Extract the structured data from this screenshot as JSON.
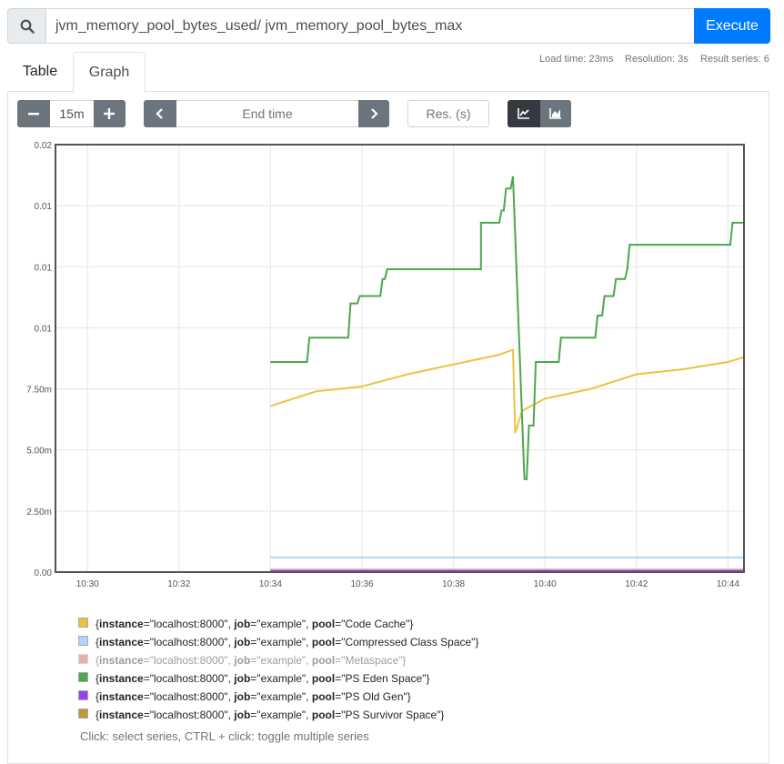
{
  "query": {
    "value": "jvm_memory_pool_bytes_used/ jvm_memory_pool_bytes_max"
  },
  "execute_label": "Execute",
  "tabs": {
    "table": "Table",
    "graph": "Graph"
  },
  "stats": {
    "load_time": "Load time: 23ms",
    "resolution": "Resolution: 3s",
    "result_series": "Result series: 6"
  },
  "controls": {
    "range": "15m",
    "end_time_placeholder": "End time",
    "res_placeholder": "Res. (s)"
  },
  "chart_data": {
    "type": "line",
    "x_ticks": [
      "10:30",
      "10:32",
      "10:34",
      "10:36",
      "10:38",
      "10:40",
      "10:42",
      "10:44"
    ],
    "y_ticks": [
      "0.00",
      "2.50m",
      "5.00m",
      "7.50m",
      "0.01",
      "0.01",
      "0.01",
      "0.02"
    ],
    "ylim": [
      0,
      0.0175
    ],
    "xlim_minutes": [
      29.3,
      44.35
    ],
    "grid": true,
    "series": [
      {
        "name": "Code Cache",
        "color": "#edc240",
        "x": [
          34.0,
          34.5,
          35.0,
          36.0,
          37.0,
          38.0,
          39.0,
          39.3,
          39.35,
          39.5,
          40.0,
          41.0,
          42.0,
          43.0,
          44.0,
          44.35
        ],
        "y": [
          0.0068,
          0.0071,
          0.0074,
          0.0076,
          0.0081,
          0.0085,
          0.0089,
          0.0091,
          0.0057,
          0.0066,
          0.0071,
          0.0075,
          0.0081,
          0.0083,
          0.0086,
          0.0088
        ]
      },
      {
        "name": "Compressed Class Space",
        "color": "#afd8f8",
        "x": [
          34.0,
          39.3,
          39.4,
          44.35
        ],
        "y": [
          0.0006,
          0.0006,
          0.0006,
          0.0006
        ]
      },
      {
        "name": "Metaspace",
        "color": "#cb4b4b",
        "x": [
          34.0,
          44.35
        ],
        "y": [
          0.0001,
          0.0001
        ]
      },
      {
        "name": "PS Eden Space",
        "color": "#4da74d",
        "x": [
          34.0,
          34.8,
          34.85,
          35.7,
          35.75,
          35.9,
          35.95,
          36.4,
          36.45,
          36.5,
          36.55,
          37.0,
          37.05,
          37.05,
          38.55,
          38.6,
          38.6,
          39.0,
          39.05,
          39.1,
          39.15,
          39.25,
          39.3,
          39.55,
          39.6,
          39.65,
          39.75,
          39.8,
          39.85,
          40.3,
          40.35,
          41.1,
          41.15,
          41.25,
          41.3,
          41.5,
          41.55,
          41.75,
          41.8,
          41.85,
          44.05,
          44.1,
          44.35
        ],
        "y": [
          0.0086,
          0.0086,
          0.0096,
          0.0096,
          0.011,
          0.011,
          0.0113,
          0.0113,
          0.012,
          0.012,
          0.0124,
          0.0124,
          0.0124,
          0.0124,
          0.0124,
          0.0124,
          0.0143,
          0.0143,
          0.0148,
          0.0148,
          0.0157,
          0.0157,
          0.0162,
          0.0038,
          0.0038,
          0.006,
          0.006,
          0.0086,
          0.0086,
          0.0086,
          0.0096,
          0.0096,
          0.0105,
          0.0105,
          0.0113,
          0.0113,
          0.012,
          0.012,
          0.0124,
          0.0134,
          0.0134,
          0.0143,
          0.0143
        ]
      },
      {
        "name": "PS Old Gen",
        "color": "#9440ed",
        "x": [
          34.0,
          44.35
        ],
        "y": [
          5e-05,
          5e-05
        ]
      },
      {
        "name": "PS Survivor Space",
        "color": "#bd9b33",
        "x": [
          34.0,
          44.35
        ],
        "y": [
          0.0,
          0.0
        ]
      }
    ]
  },
  "legend": {
    "items": [
      {
        "color": "#edc240",
        "instance": "\"localhost:8000\"",
        "job": "\"example\"",
        "pool": "\"Code Cache\"",
        "dim": false
      },
      {
        "color": "#afd8f8",
        "instance": "\"localhost:8000\"",
        "job": "\"example\"",
        "pool": "\"Compressed Class Space\"",
        "dim": false
      },
      {
        "color": "#cb4b4b",
        "instance": "\"localhost:8000\"",
        "job": "\"example\"",
        "pool": "\"Metaspace\"",
        "dim": true
      },
      {
        "color": "#4da74d",
        "instance": "\"localhost:8000\"",
        "job": "\"example\"",
        "pool": "\"PS Eden Space\"",
        "dim": false
      },
      {
        "color": "#9440ed",
        "instance": "\"localhost:8000\"",
        "job": "\"example\"",
        "pool": "\"PS Old Gen\"",
        "dim": false
      },
      {
        "color": "#bd9b33",
        "instance": "\"localhost:8000\"",
        "job": "\"example\"",
        "pool": "\"PS Survivor Space\"",
        "dim": false
      }
    ],
    "hint": "Click: select series, CTRL + click: toggle multiple series"
  }
}
